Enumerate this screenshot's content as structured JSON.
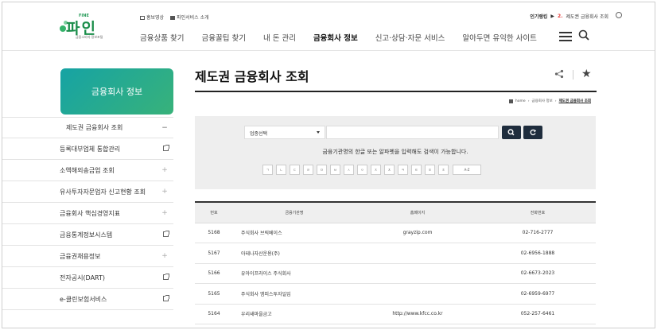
{
  "header": {
    "logo_tag": "FINE",
    "logo_text": "파인",
    "logo_sub": "금융소비자 정보포털",
    "top_links": [
      "홍보영상",
      "파인서비스 소개"
    ],
    "popular_label": "인기랭킹",
    "popular_rank": "2.",
    "popular_item": "제도권 금융회사 조회",
    "nav": [
      "금융상품 찾기",
      "금융꿀팁 찾기",
      "내 돈 관리",
      "금융회사 정보",
      "신고·상담·자문 서비스",
      "알아두면 유익한 사이트"
    ],
    "active_nav": "금융회사 정보"
  },
  "sidebar": {
    "title": "금융회사 정보",
    "items": [
      {
        "label": "제도권 금융회사 조회",
        "mark": "−"
      },
      {
        "label": "등록대부업체 통합관리",
        "mark": "ext"
      },
      {
        "label": "소액해외송금업 조회",
        "mark": "+"
      },
      {
        "label": "유사투자자문업자 신고현황 조회",
        "mark": "+"
      },
      {
        "label": "금융회사 핵심경영지표",
        "mark": "+"
      },
      {
        "label": "금융통계정보시스템",
        "mark": "ext"
      },
      {
        "label": "금융권채용정보",
        "mark": "+"
      },
      {
        "label": "전자공시(DART)",
        "mark": "ext"
      },
      {
        "label": "e-클린보험서비스",
        "mark": "ext"
      }
    ]
  },
  "main": {
    "title": "제도권 금융회사 조회",
    "breadcrumb": [
      "home",
      "금융회사 정보",
      "제도권 금융회사 조회"
    ],
    "search": {
      "select_value": "업종선택",
      "input_value": "",
      "help": "금융기관명의 한글 또는 알파벳을 입력해도 검색이 가능합니다.",
      "consonants": [
        "ㄱ",
        "ㄴ",
        "ㄷ",
        "ㄹ",
        "ㅁ",
        "ㅂ",
        "ㅅ",
        "ㅇ",
        "ㅈ",
        "ㅊ",
        "ㅋ",
        "ㅌ",
        "ㅍ",
        "ㅎ",
        "A-Z"
      ]
    },
    "table": {
      "columns": [
        "번호",
        "금융기관명",
        "홈페이지",
        "전화번호"
      ],
      "rows": [
        {
          "no": "5168",
          "name": "주식회사 브릭베이스",
          "home": "grayzip.com",
          "tel": "02-716-2777"
        },
        {
          "no": "5167",
          "name": "아테나자산운용(주)",
          "home": "",
          "tel": "02-6956-1888"
        },
        {
          "no": "5166",
          "name": "유아이프라이스 주식회사",
          "home": "",
          "tel": "02-6673-2023"
        },
        {
          "no": "5165",
          "name": "주식회사 엠피스투자일임",
          "home": "",
          "tel": "02-6959-6977"
        },
        {
          "no": "5164",
          "name": "우리새마을금고",
          "home": "http://www.kfcc.co.kr",
          "tel": "052-257-6461"
        }
      ]
    }
  }
}
